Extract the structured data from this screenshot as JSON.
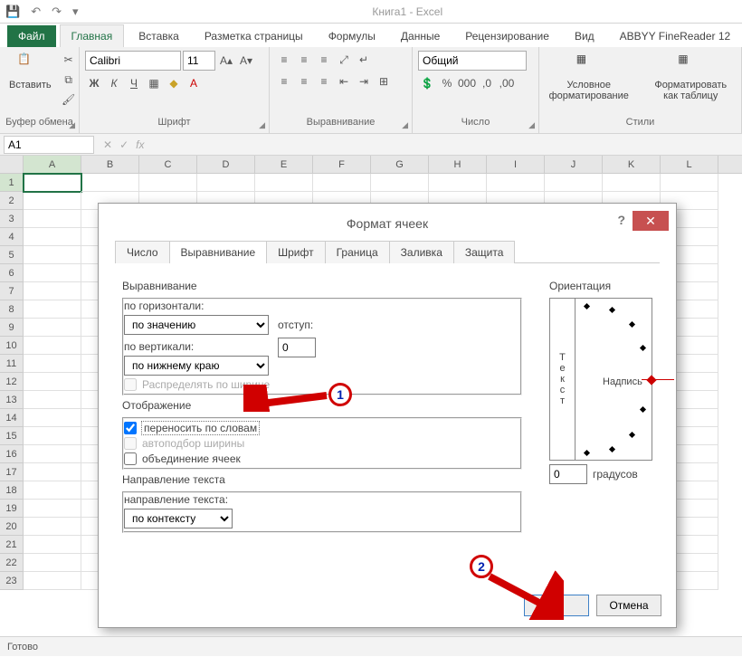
{
  "title": "Книга1 - Excel",
  "qat": {
    "save": "💾",
    "undo": "↶",
    "redo": "↷"
  },
  "tabs": [
    "Файл",
    "Главная",
    "Вставка",
    "Разметка страницы",
    "Формулы",
    "Данные",
    "Рецензирование",
    "Вид",
    "ABBYY FineReader 12"
  ],
  "activeTab": "Главная",
  "ribbon": {
    "clipboard": {
      "label": "Буфер обмена",
      "paste": "Вставить"
    },
    "font": {
      "label": "Шрифт",
      "name": "Calibri",
      "size": "11",
      "bold": "Ж",
      "italic": "К",
      "underline": "Ч"
    },
    "align": {
      "label": "Выравнивание"
    },
    "number": {
      "label": "Число",
      "format": "Общий"
    },
    "styles": {
      "label": "Стили",
      "cond": "Условное форматирование",
      "table": "Форматировать как таблицу"
    }
  },
  "namebox": "A1",
  "columns": [
    "A",
    "B",
    "C",
    "D",
    "E",
    "F",
    "G",
    "H",
    "I",
    "J",
    "K",
    "L"
  ],
  "rows": [
    1,
    2,
    3,
    4,
    5,
    6,
    7,
    8,
    9,
    10,
    11,
    12,
    13,
    14,
    15,
    16,
    17,
    18,
    19,
    20,
    21,
    22,
    23
  ],
  "status": "Готово",
  "dialog": {
    "title": "Формат ячеек",
    "help": "?",
    "close": "✕",
    "tabs": [
      "Число",
      "Выравнивание",
      "Шрифт",
      "Граница",
      "Заливка",
      "Защита"
    ],
    "activeTab": "Выравнивание",
    "alignment": {
      "sectionAlign": "Выравнивание",
      "horizLabel": "по горизонтали:",
      "horizValue": "по значению",
      "indentLabel": "отступ:",
      "indentValue": "0",
      "vertLabel": "по вертикали:",
      "vertValue": "по нижнему краю",
      "distribute": "Распределять по ширине",
      "sectionDisplay": "Отображение",
      "wrap": "переносить по словам",
      "shrink": "автоподбор ширины",
      "merge": "объединение ячеек",
      "sectionDir": "Направление текста",
      "dirLabel": "направление текста:",
      "dirValue": "по контексту"
    },
    "orientation": {
      "title": "Ориентация",
      "vertText": "Текст",
      "innerLabel": "Надпись",
      "degrees": "0",
      "degLabel": "градусов"
    },
    "ok": "ОК",
    "cancel": "Отмена"
  },
  "callouts": {
    "one": "1",
    "two": "2"
  }
}
